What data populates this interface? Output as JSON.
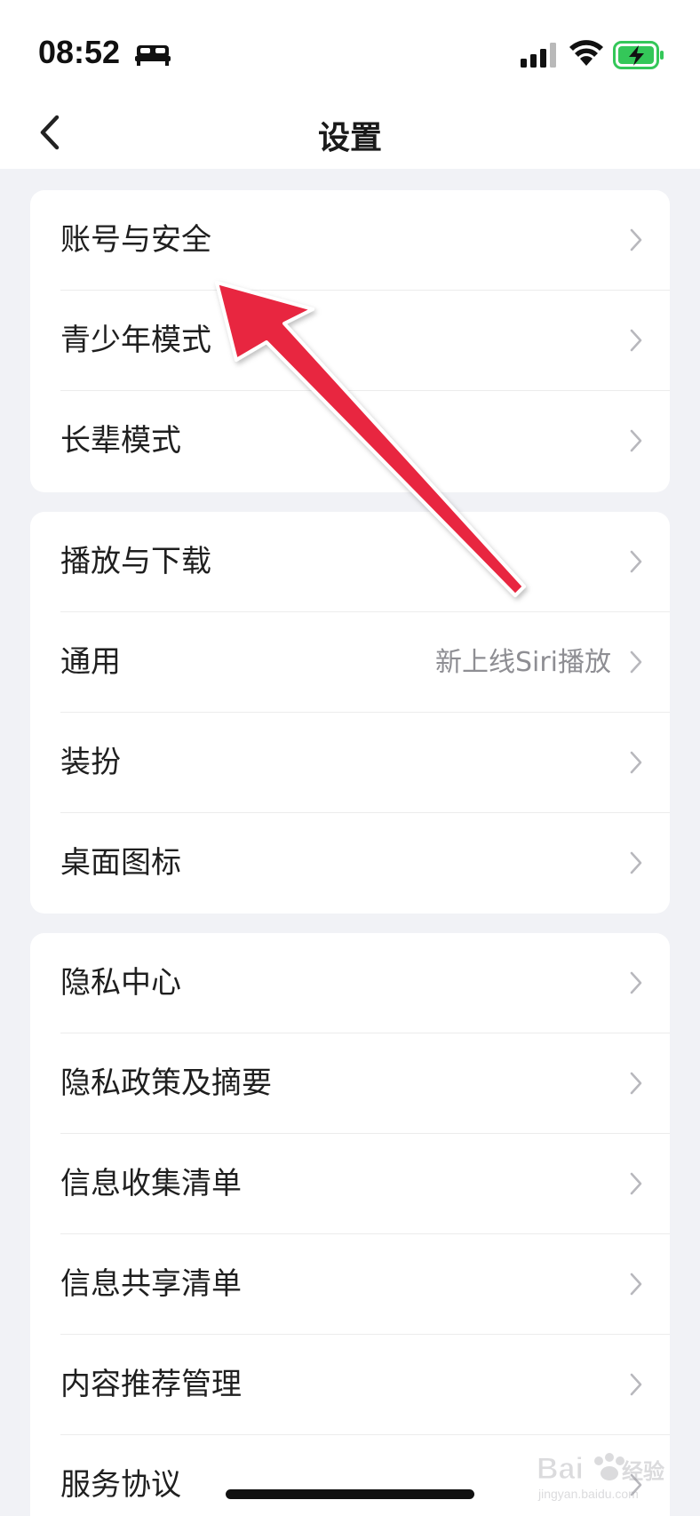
{
  "status_bar": {
    "time": "08:52"
  },
  "nav": {
    "title": "设置"
  },
  "groups": [
    {
      "items": [
        {
          "label": "账号与安全",
          "value": ""
        },
        {
          "label": "青少年模式",
          "value": ""
        },
        {
          "label": "长辈模式",
          "value": ""
        }
      ]
    },
    {
      "items": [
        {
          "label": "播放与下载",
          "value": ""
        },
        {
          "label": "通用",
          "value": "新上线Siri播放"
        },
        {
          "label": "装扮",
          "value": ""
        },
        {
          "label": "桌面图标",
          "value": ""
        }
      ]
    },
    {
      "items": [
        {
          "label": "隐私中心",
          "value": ""
        },
        {
          "label": "隐私政策及摘要",
          "value": ""
        },
        {
          "label": "信息收集清单",
          "value": ""
        },
        {
          "label": "信息共享清单",
          "value": ""
        },
        {
          "label": "内容推荐管理",
          "value": ""
        },
        {
          "label": "服务协议",
          "value": ""
        }
      ]
    }
  ],
  "watermark": {
    "brand": "Bai du 经验",
    "url": "jingyan.baidu.com"
  },
  "colors": {
    "background": "#f1f2f6",
    "card": "#ffffff",
    "text": "#1f1f1f",
    "secondary_text": "#8e8e93",
    "arrow": "#e8283f",
    "battery_fill": "#34c759"
  },
  "icons": [
    "bed-icon",
    "signal-icon",
    "wifi-icon",
    "battery-charging-icon",
    "back-chevron-icon",
    "chevron-right-icon"
  ]
}
